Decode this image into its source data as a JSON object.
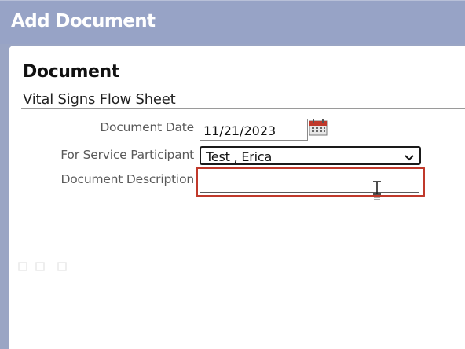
{
  "window": {
    "title": "Add Document"
  },
  "section": {
    "title": "Document",
    "document_name": "Vital Signs Flow Sheet"
  },
  "form": {
    "document_date": {
      "label": "Document Date",
      "value": "11/21/2023"
    },
    "service_participant": {
      "label": "For Service Participant",
      "selected": "Test , Erica"
    },
    "document_description": {
      "label": "Document Description",
      "value": ""
    }
  },
  "icons": {
    "calendar": "calendar-icon",
    "dropdown": "chevron-down-icon",
    "text_cursor": "text-cursor-icon"
  },
  "colors": {
    "titlebar": "#97a3c6",
    "highlight": "#c0392b",
    "calendar_accent": "#c0392b"
  }
}
